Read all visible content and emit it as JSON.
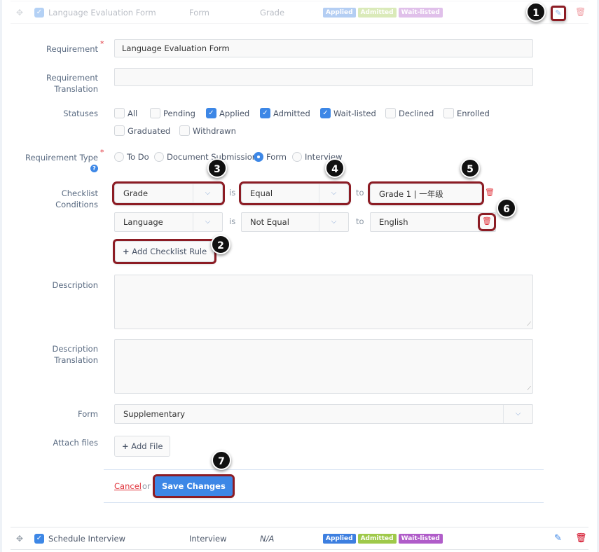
{
  "rows": [
    {
      "name": "Language Evaluation Form",
      "type": "Form",
      "condition": "Grade",
      "badges": [
        "Applied",
        "Admitted",
        "Wait-listed"
      ],
      "dimmed": true
    },
    {
      "name": "Schedule Interview",
      "type": "Interview",
      "condition": "N/A",
      "badges": [
        "Applied",
        "Admitted",
        "Wait-listed"
      ],
      "dimmed": false
    }
  ],
  "badge_colors": {
    "Applied": "#3d7fe0",
    "Admitted": "#9fc94a",
    "Wait-listed": "#b05cc9"
  },
  "form": {
    "requirement_label": "Requirement",
    "requirement_value": "Language Evaluation Form",
    "requirement_translation_label_1": "Requirement",
    "requirement_translation_label_2": "Translation",
    "requirement_translation_value": "",
    "statuses_label": "Statuses",
    "statuses": [
      {
        "label": "All",
        "checked": false
      },
      {
        "label": "Pending",
        "checked": false
      },
      {
        "label": "Applied",
        "checked": true
      },
      {
        "label": "Admitted",
        "checked": true
      },
      {
        "label": "Wait-listed",
        "checked": true
      },
      {
        "label": "Declined",
        "checked": false
      },
      {
        "label": "Enrolled",
        "checked": false
      },
      {
        "label": "Graduated",
        "checked": false
      },
      {
        "label": "Withdrawn",
        "checked": false
      }
    ],
    "requirement_type_label": "Requirement Type",
    "requirement_types": [
      {
        "label": "To Do",
        "selected": false
      },
      {
        "label": "Document Submission",
        "selected": false
      },
      {
        "label": "Form",
        "selected": true
      },
      {
        "label": "Interview",
        "selected": false
      }
    ],
    "checklist_label_1": "Checklist",
    "checklist_label_2": "Conditions",
    "conditions": [
      {
        "field": "Grade",
        "is": "is",
        "operator": "Equal",
        "to": "to",
        "value": "Grade 1 | 一年级"
      },
      {
        "field": "Language",
        "is": "is",
        "operator": "Not Equal",
        "to": "to",
        "value": "English"
      }
    ],
    "add_rule_label": "Add Checklist Rule",
    "description_label": "Description",
    "description_value": "",
    "description_translation_label_1": "Description",
    "description_translation_label_2": "Translation",
    "description_translation_value": "",
    "form_label": "Form",
    "form_value": "Supplementary",
    "attach_label": "Attach files",
    "add_file_label": "Add File",
    "cancel_label": "Cancel",
    "or_label": "or",
    "save_label": "Save Changes"
  },
  "callouts": [
    "1",
    "2",
    "3",
    "4",
    "5",
    "6",
    "7"
  ],
  "icons": {
    "move": "✥",
    "check": "✓",
    "edit": "✎",
    "trash": "🗑",
    "chevron": "⌵",
    "plus": "+",
    "help": "?"
  }
}
